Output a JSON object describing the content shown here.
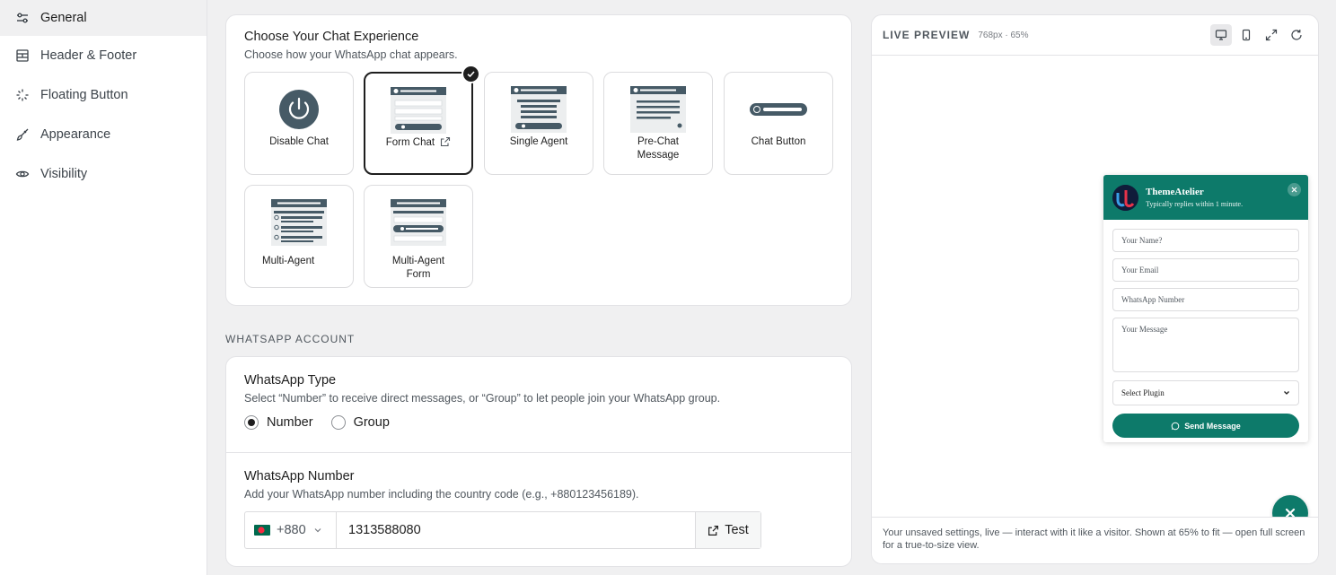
{
  "sidebar": {
    "items": [
      {
        "label": "General",
        "icon": "sliders-icon",
        "active": true
      },
      {
        "label": "Header & Footer",
        "icon": "layout-icon"
      },
      {
        "label": "Floating Button",
        "icon": "sparkle-icon"
      },
      {
        "label": "Appearance",
        "icon": "brush-icon"
      },
      {
        "label": "Visibility",
        "icon": "eye-icon"
      }
    ]
  },
  "experience": {
    "title": "Choose Your Chat Experience",
    "description": "Choose how your WhatsApp chat appears.",
    "options": [
      {
        "label": "Disable Chat"
      },
      {
        "label": "Form Chat",
        "selected": true
      },
      {
        "label": "Single Agent"
      },
      {
        "label": "Pre-Chat Message"
      },
      {
        "label": "Chat Button"
      },
      {
        "label": "Multi-Agent"
      },
      {
        "label": "Multi-Agent Form"
      }
    ]
  },
  "whatsapp_account": {
    "section_label": "WHATSAPP ACCOUNT",
    "type": {
      "title": "WhatsApp Type",
      "description": "Select “Number” to receive direct messages, or “Group” to let people join your WhatsApp group.",
      "options": [
        "Number",
        "Group"
      ],
      "selected": "Number"
    },
    "number": {
      "title": "WhatsApp Number",
      "description": "Add your WhatsApp number including the country code (e.g., +880123456189).",
      "country_code": "+880",
      "value": "1313588080",
      "test_label": "Test"
    }
  },
  "preview": {
    "title": "LIVE PREVIEW",
    "meta": "768px · 65%",
    "footer": "Your unsaved settings, live — interact with it like a visitor. Shown at 65% to fit — open full screen for a true-to-size view.",
    "widget": {
      "name": "ThemeAtelier",
      "subtitle": "Typically replies within 1 minute.",
      "fields": [
        "Your Name?",
        "Your Email",
        "WhatsApp Number"
      ],
      "message_placeholder": "Your Message",
      "select_label": "Select Plugin",
      "send_label": "Send Message"
    }
  },
  "colors": {
    "accent": "#0d7a6a",
    "selected_border": "#1e1e1e"
  }
}
